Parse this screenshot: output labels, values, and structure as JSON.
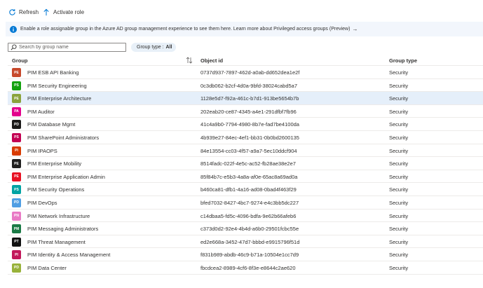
{
  "toolbar": {
    "refresh_label": "Refresh",
    "activate_label": "Activate role"
  },
  "banner": {
    "text": "Enable a role assignable group in the Azure AD group management experience to see them here. Learn more about Privileged access groups (Preview)",
    "arrow": "→"
  },
  "filters": {
    "search_placeholder": "Search by group name",
    "pill_label": "Group type :",
    "pill_value": "All"
  },
  "grid": {
    "headers": {
      "group": "Group",
      "object_id": "Object id",
      "group_type": "Group type"
    },
    "rows": [
      {
        "initials": "PE",
        "color": "#c7482b",
        "name": "PIM ESB API Banking",
        "object_id": "0737d937-7897-462d-a0ab-dd652dea1e2f",
        "type": "Security"
      },
      {
        "initials": "PS",
        "color": "#13a10e",
        "name": "PIM Security Engineering",
        "object_id": "0c3db062-b2cf-4d0a-9bfd-38024cabd5a7",
        "type": "Security"
      },
      {
        "initials": "PE",
        "color": "#8aa33c",
        "name": "PIM Enterprise Architecture",
        "object_id": "1128e5d7-f92a-461c-b7d1-913be5654b7b",
        "type": "Security",
        "selected": true
      },
      {
        "initials": "PA",
        "color": "#e3008c",
        "name": "PIM Auditor",
        "object_id": "202eab20-ce87-4345-a4e1-291dfbf7fb96",
        "type": "Security"
      },
      {
        "initials": "PD",
        "color": "#1b1a19",
        "name": "PIM Database Mgmt",
        "object_id": "41c4a9b0-7794-4980-8b7e-fad7be4100da",
        "type": "Security"
      },
      {
        "initials": "PS",
        "color": "#c30052",
        "name": "PIM SharePoint Administrators",
        "object_id": "4b939e27-84ec-4ef1-bb31-0b0bd2600135",
        "type": "Security"
      },
      {
        "initials": "PI",
        "color": "#d83b01",
        "name": "PIM IPAOPS",
        "object_id": "84e13554-cc03-4f57-a9a7-5ec10ddcf904",
        "type": "Security"
      },
      {
        "initials": "PE",
        "color": "#201f1e",
        "name": "PIM Enterprise Mobility",
        "object_id": "8514fadc-022f-4e5c-ac52-fb28ae38e2e7",
        "type": "Security"
      },
      {
        "initials": "PE",
        "color": "#e81123",
        "name": "PIM Enterprise Application Admin",
        "object_id": "85f84b7c-e5b3-4a8a-af0e-65ac8a69ad0a",
        "type": "Security"
      },
      {
        "initials": "PS",
        "color": "#00a3a3",
        "name": "PIM Security Operations",
        "object_id": "b460ca81-dfb1-4a16-ad08-0bad4f463f29",
        "type": "Security"
      },
      {
        "initials": "PD",
        "color": "#4f9ee3",
        "name": "PIM DevOps",
        "object_id": "bfed7032-8427-4bc7-9274-e4c3bb5dc227",
        "type": "Security"
      },
      {
        "initials": "PN",
        "color": "#e97ac5",
        "name": "PIM Network Infrastructure",
        "object_id": "c14dbaa5-fd5c-4096-bdfa-9e62b66afeb6",
        "type": "Security"
      },
      {
        "initials": "PM",
        "color": "#1a7a45",
        "name": "PIM Messaging Administrators",
        "object_id": "c373d0d2-92e4-4b4d-a6b0-29501fcbc55e",
        "type": "Security"
      },
      {
        "initials": "PT",
        "color": "#111111",
        "name": "PIM Threat Management",
        "object_id": "ed2e668a-3452-47d7-bbbd-e9915796f51d",
        "type": "Security"
      },
      {
        "initials": "PI",
        "color": "#c2185b",
        "name": "PIM Identity & Access Management",
        "object_id": "f831b989-abdb-46c9-b71a-10504e1cc7d9",
        "type": "Security"
      },
      {
        "initials": "PD",
        "color": "#98b23a",
        "name": "PIM Data Center",
        "object_id": "fbcdcea2-8989-4cf6-8f3e-e8644c2ae620",
        "type": "Security"
      }
    ]
  }
}
